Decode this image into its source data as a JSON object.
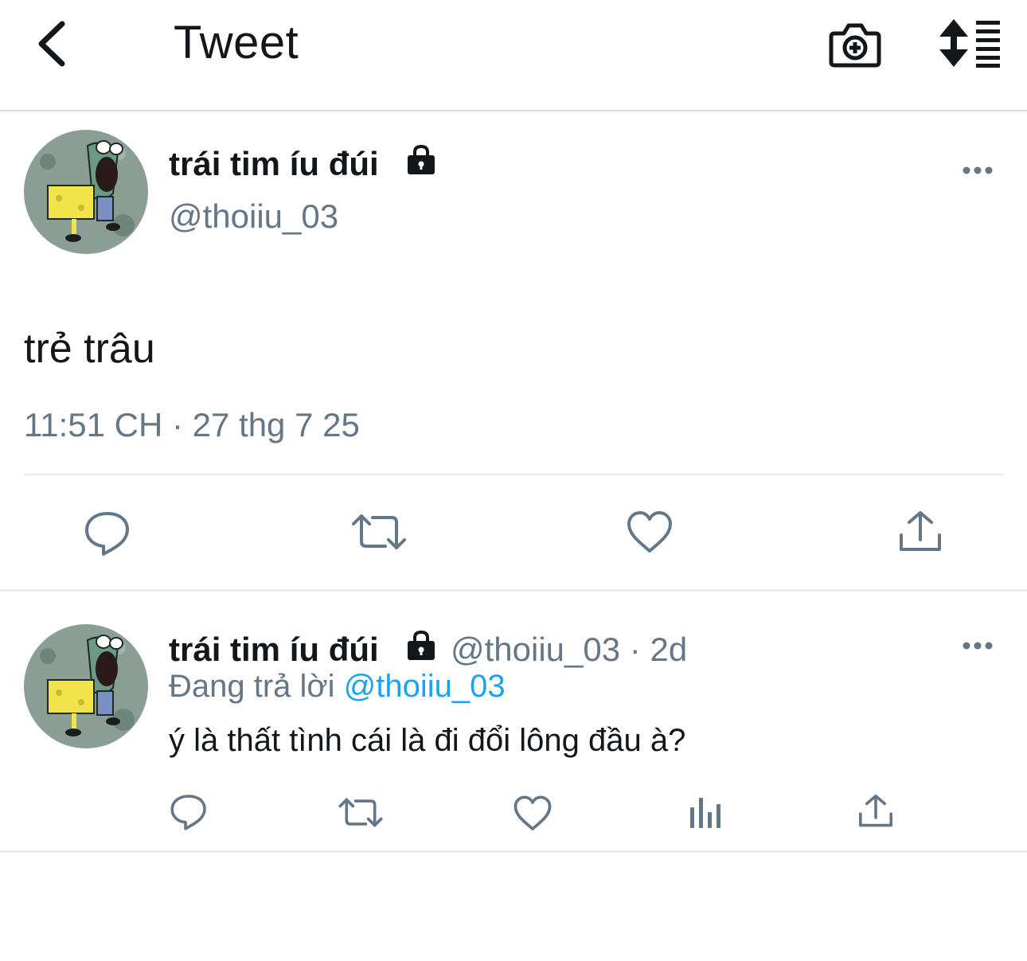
{
  "header": {
    "title": "Tweet",
    "back_icon": "chevron-left-icon",
    "camera_icon": "camera-plus-icon",
    "sort_icon": "sort-list-icon"
  },
  "main_tweet": {
    "display_name": "trái tim íu đúi",
    "protected_icon": "lock-icon",
    "handle": "@thoiiu_03",
    "text": "trẻ trâu",
    "timestamp": "11:51 CH · 27 thg 7 25",
    "actions": [
      "reply-icon",
      "retweet-icon",
      "like-icon",
      "share-icon"
    ]
  },
  "reply_tweet": {
    "display_name": "trái tim íu đúi",
    "handle": "@thoiiu_03",
    "separator": "·",
    "age": "2d",
    "replying_label": "Đang trả lời",
    "replying_to": "@thoiiu_03",
    "text": "ý là thất tình cái là đi đổi lông đầu à?",
    "actions": [
      "reply-icon",
      "retweet-icon",
      "like-icon",
      "analytics-icon",
      "share-icon"
    ]
  },
  "colors": {
    "text": "#14171a",
    "secondary": "#657786",
    "link": "#1da1f2",
    "divider": "#e6ecf0"
  }
}
